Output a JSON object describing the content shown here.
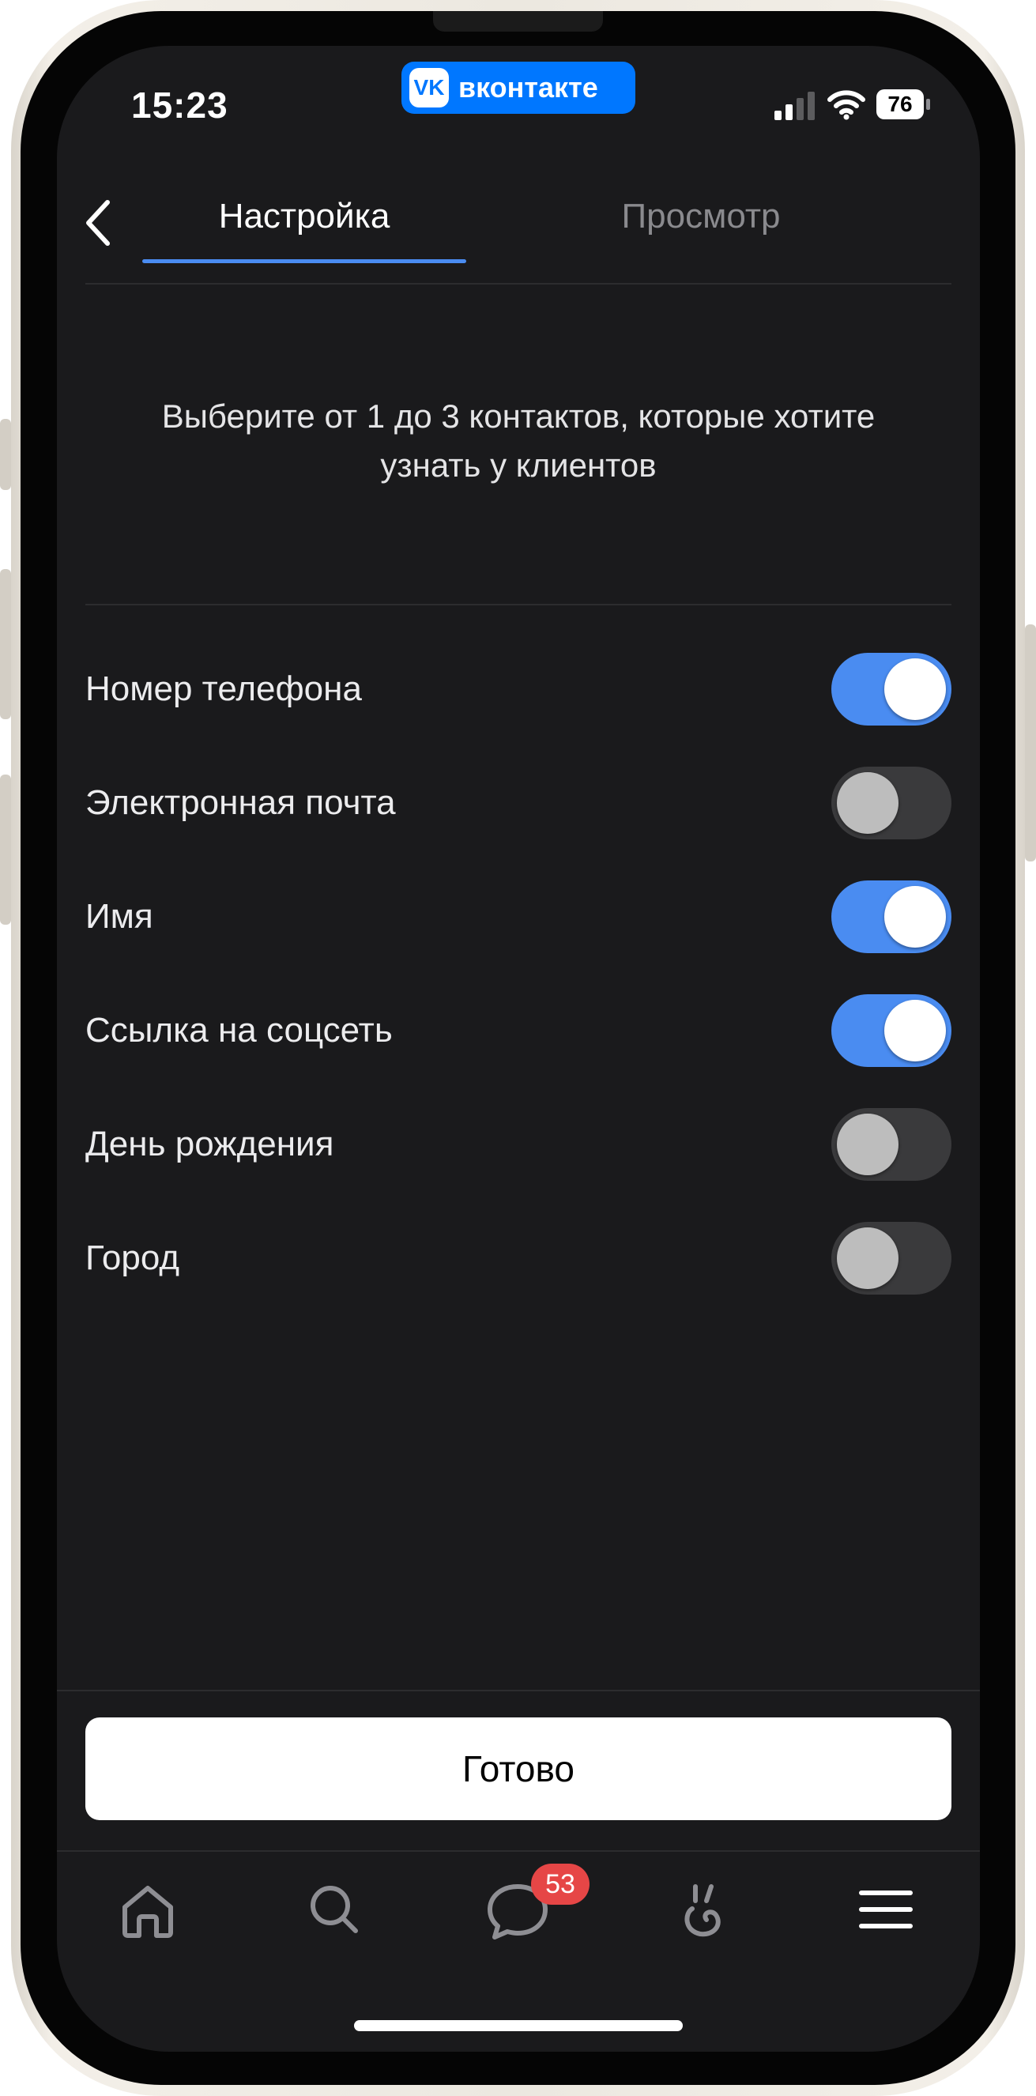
{
  "status_bar": {
    "time": "15:23",
    "app_badge": "вконтакте",
    "battery": "76"
  },
  "tabs": [
    {
      "label": "Настройка",
      "active": true
    },
    {
      "label": "Просмотр",
      "active": false
    }
  ],
  "hint": "Выберите от 1 до 3 контактов, которые хотите узнать у клиентов",
  "options": [
    {
      "label": "Номер телефона",
      "enabled": true
    },
    {
      "label": "Электронная почта",
      "enabled": false
    },
    {
      "label": "Имя",
      "enabled": true
    },
    {
      "label": "Ссылка на соцсеть",
      "enabled": true
    },
    {
      "label": "День рождения",
      "enabled": false
    },
    {
      "label": "Город",
      "enabled": false
    }
  ],
  "done_button": "Готово",
  "tab_bar": {
    "items": [
      "home-icon",
      "search-icon",
      "messages-icon",
      "clips-icon",
      "menu-icon"
    ],
    "messages_badge": "53"
  },
  "colors": {
    "accent": "#4a8cf1",
    "background": "#1a1a1c",
    "badge": "#e64646",
    "vk_brand": "#0077ff"
  }
}
